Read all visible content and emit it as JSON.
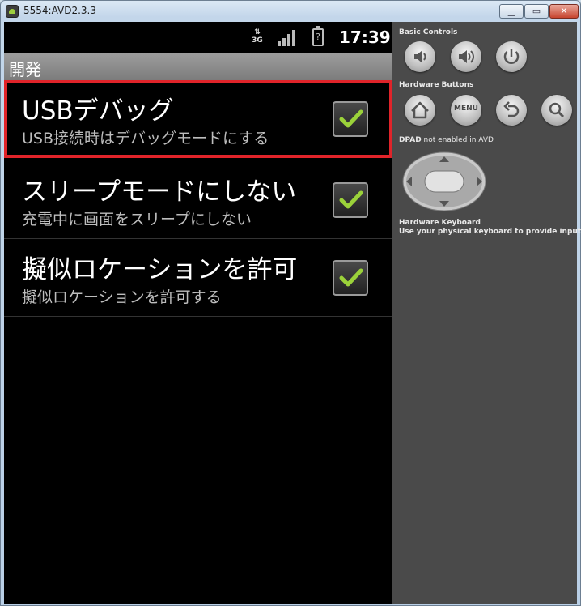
{
  "window": {
    "title": "5554:AVD2.3.3",
    "minimize_icon": "minimize-icon",
    "maximize_icon": "maximize-icon",
    "close_icon": "close-icon"
  },
  "statusbar": {
    "network": "3G",
    "battery_glyph": "?",
    "time": "17:39"
  },
  "screen_title": "開発",
  "preferences": [
    {
      "title": "USBデバッグ",
      "summary": "USB接続時はデバッグモードにする",
      "checked": true,
      "highlighted": true
    },
    {
      "title": "スリープモードにしない",
      "summary": "充電中に画面をスリープにしない",
      "checked": true,
      "highlighted": false
    },
    {
      "title": "擬似ロケーションを許可",
      "summary": "擬似ロケーションを許可する",
      "checked": true,
      "highlighted": false
    }
  ],
  "controls": {
    "basic_label": "Basic Controls",
    "hardware_buttons_label": "Hardware Buttons",
    "menu_label": "MENU",
    "dpad_label_bold": "DPAD",
    "dpad_label_rest": " not enabled in AVD",
    "keyboard_label": "Hardware Keyboard",
    "keyboard_hint": "Use your physical keyboard to provide input"
  },
  "colors": {
    "highlight": "#e0242a",
    "check": "#9bd23a",
    "panel_bg": "#4a4a4a"
  }
}
